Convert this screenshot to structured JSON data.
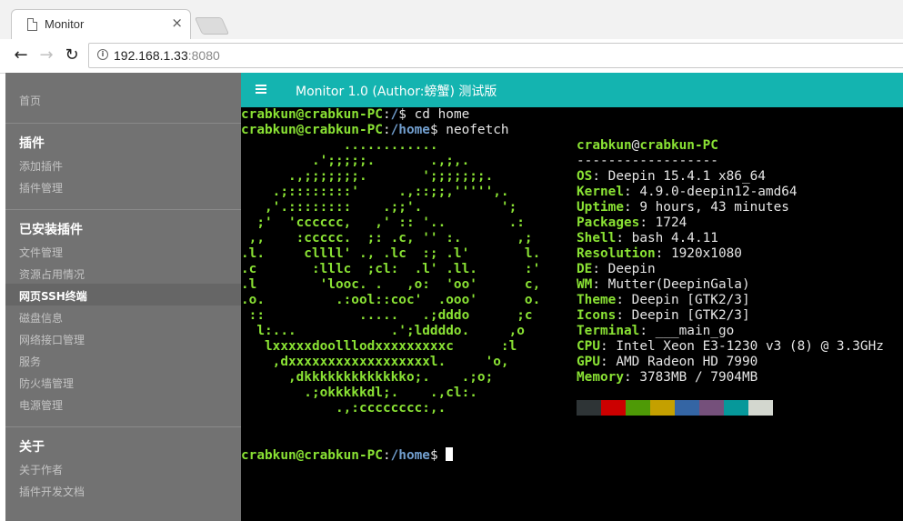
{
  "browser": {
    "tab_title": "Monitor",
    "close_glyph": "×",
    "url_host": "192.168.1.33",
    "url_port": ":8080",
    "back_glyph": "←",
    "forward_glyph": "→",
    "reload_glyph": "↻",
    "info_glyph": "i"
  },
  "sidebar": {
    "home": "首页",
    "plugins_heading": "插件",
    "add_plugin": "添加插件",
    "manage_plugins": "插件管理",
    "installed_heading": "已安装插件",
    "installed_items": [
      "文件管理",
      "资源占用情况",
      "网页SSH终端",
      "磁盘信息",
      "网络接口管理",
      "服务",
      "防火墙管理",
      "电源管理"
    ],
    "active_index": 2,
    "about_heading": "关于",
    "about_author": "关于作者",
    "plugin_docs": "插件开发文档"
  },
  "header": {
    "title": "Monitor 1.0 (Author:螃蟹) 测试版"
  },
  "terminal": {
    "prompt_user": "crabkun@crabkun-PC",
    "cmd1_path": "/",
    "cmd1": "cd home",
    "cmd2_path": "/home",
    "cmd2": "neofetch",
    "prompt_sep": ":",
    "prompt_dollar": "$ ",
    "logo": [
      "             ............",
      "         .';;;;;.       .,;,.",
      "      .,;;;;;;;.       ';;;;;;;.",
      "    .;::::::::'     .,::;;,''''',.",
      "   ,'.::::::::    .;;'.          ';",
      "  ;'  'cccccc,   ,' :: '..        .:",
      " ,,    :ccccc.  ;: .c, '' :.       ,;",
      ".l.     cllll' ., .lc  :; .l'       l.",
      ".c       :lllc  ;cl:  .l' .ll.      :'",
      ".l        'looc. .   ,o:  'oo'      c,",
      ".o.         .:ool::coc'  .ooo'      o.",
      " ::            .....   .;dddo      ;c",
      "  l:...            .';lddddo.     ,o",
      "   lxxxxxdoolllodxxxxxxxxxc      :l",
      "    ,dxxxxxxxxxxxxxxxxxxl.     'o,",
      "      ,dkkkkkkkkkkkkko;.    .;o;",
      "        .;okkkkkdl;.    .,cl:.",
      "            .,:cccccccc:,."
    ],
    "info_user": "crabkun",
    "info_at": "@",
    "info_host": "crabkun-PC",
    "divider": "------------------",
    "info": [
      {
        "key": "OS",
        "value": "Deepin 15.4.1 x86_64"
      },
      {
        "key": "Kernel",
        "value": "4.9.0-deepin12-amd64"
      },
      {
        "key": "Uptime",
        "value": "9 hours, 43 minutes"
      },
      {
        "key": "Packages",
        "value": "1724"
      },
      {
        "key": "Shell",
        "value": "bash 4.4.11"
      },
      {
        "key": "Resolution",
        "value": "1920x1080"
      },
      {
        "key": "DE",
        "value": "Deepin"
      },
      {
        "key": "WM",
        "value": "Mutter(DeepinGala)"
      },
      {
        "key": "Theme",
        "value": "Deepin [GTK2/3]"
      },
      {
        "key": "Icons",
        "value": "Deepin [GTK2/3]"
      },
      {
        "key": "Terminal",
        "value": "___main_go"
      },
      {
        "key": "CPU",
        "value": "Intel Xeon E3-1230 v3 (8) @ 3.3GHz"
      },
      {
        "key": "GPU",
        "value": "AMD Radeon HD 7990"
      },
      {
        "key": "Memory",
        "value": "3783MB / 7904MB"
      }
    ],
    "key_sep": ": ",
    "palette": [
      "#2e3436",
      "#cc0000",
      "#4e9a06",
      "#c4a000",
      "#3465a4",
      "#75507b",
      "#06989a",
      "#d3d7cf"
    ],
    "final_path": "/home"
  }
}
